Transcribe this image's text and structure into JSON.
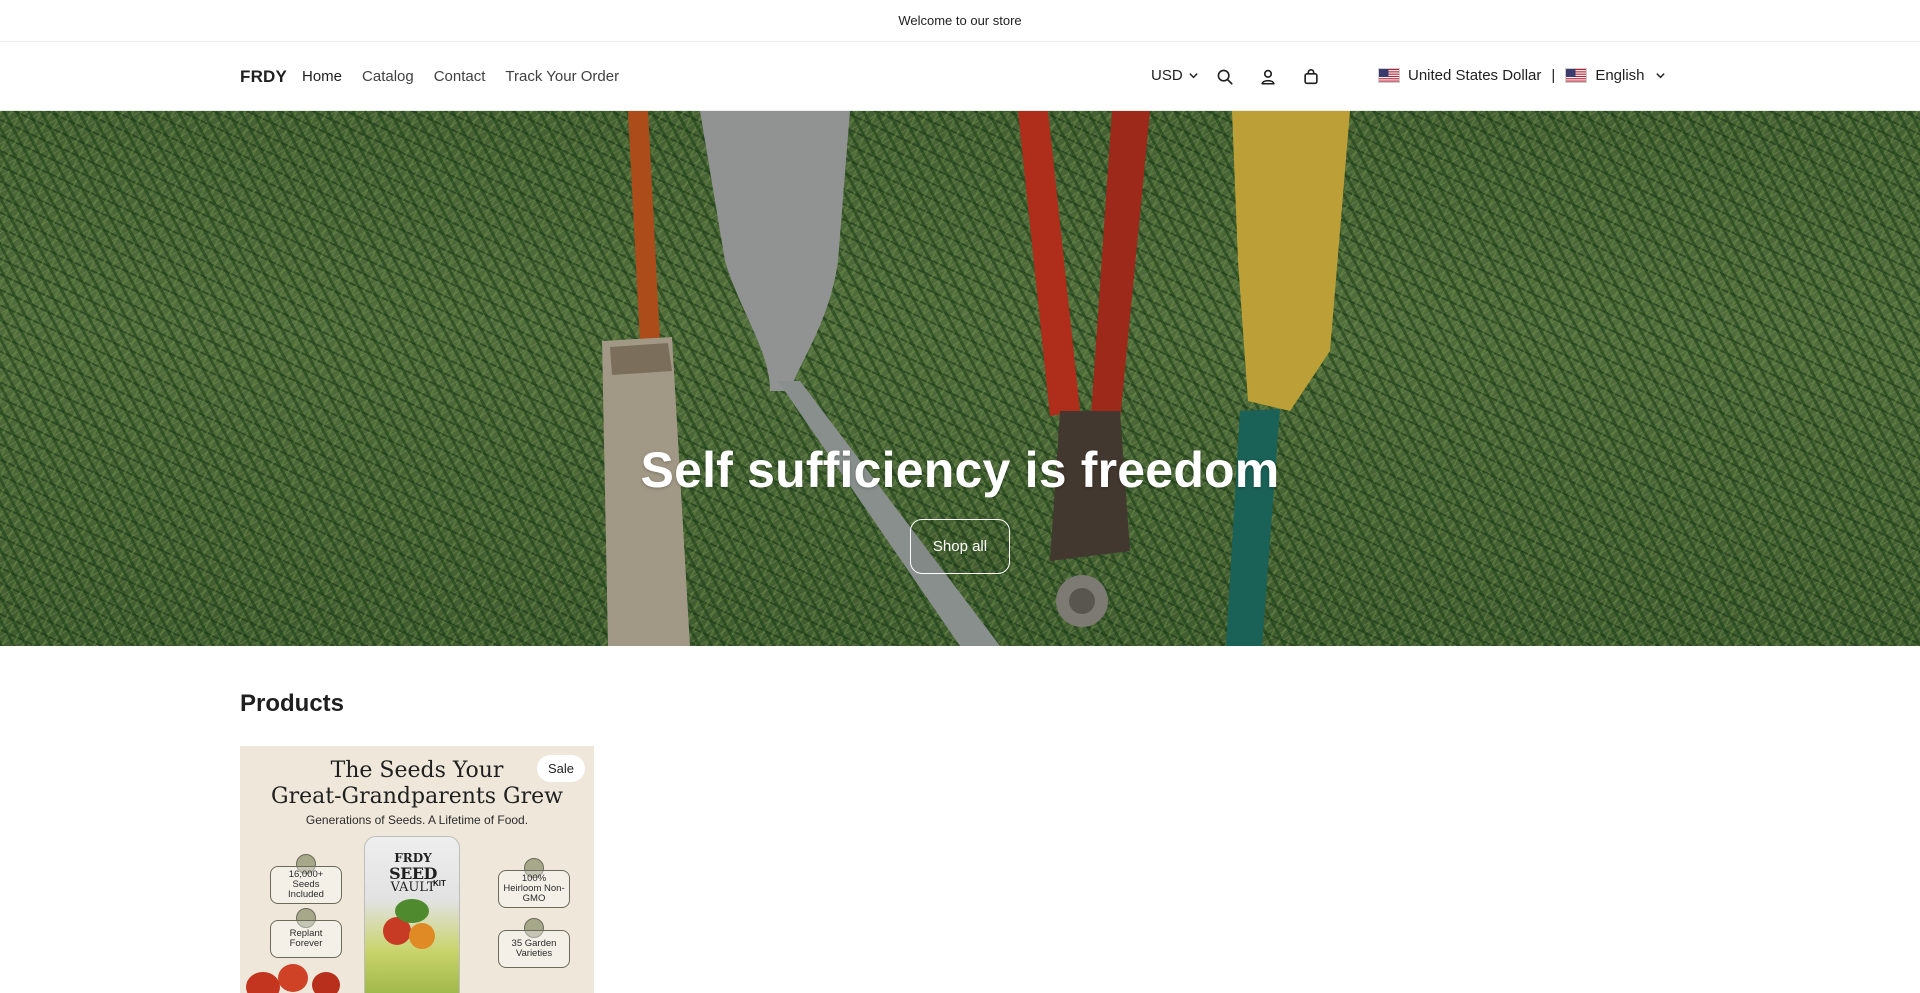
{
  "announcement": {
    "text": "Welcome to our store"
  },
  "header": {
    "logo": "FRDY",
    "nav": [
      {
        "label": "Home"
      },
      {
        "label": "Catalog"
      },
      {
        "label": "Contact"
      },
      {
        "label": "Track Your Order"
      }
    ],
    "currency": "USD",
    "icons": [
      "search-icon",
      "account-icon",
      "cart-icon"
    ],
    "localization": {
      "country": "United States Dollar",
      "divider": "|",
      "language": "English"
    }
  },
  "hero": {
    "title": "Self sufficiency is freedom",
    "button_label": "Shop all"
  },
  "products": {
    "title": "Products",
    "items": [
      {
        "badge": "Sale",
        "image": {
          "headline_line1": "The Seeds Your",
          "headline_line2": "Great-Grandparents Grew",
          "subline": "Generations of Seeds. A Lifetime of Food.",
          "features": [
            "16,000+ Seeds Included",
            "100% Heirloom Non-GMO",
            "Replant Forever",
            "35 Garden Varieties"
          ],
          "pouch": {
            "brand": "FRDY",
            "line1": "SEED",
            "line2": "VAULT",
            "tag": "KIT"
          }
        }
      }
    ]
  },
  "colors": {
    "text": "#1f1f1f",
    "border": "#ececec",
    "hero_grass": "#4f6f3b",
    "badge_bg": "#ffffff"
  }
}
